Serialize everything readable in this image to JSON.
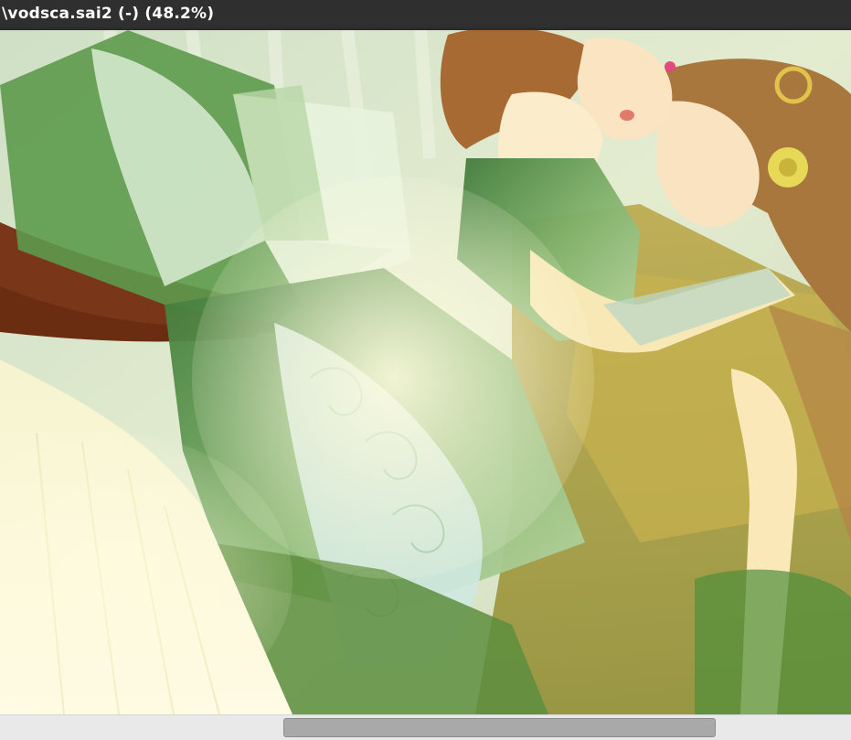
{
  "window": {
    "title": "\\vodsca.sai2 (-) (48.2%)"
  },
  "canvas": {
    "content": "illustration",
    "zoom_percent": 48.2
  },
  "scrollbar": {
    "horizontal_position_fraction": 0.333,
    "horizontal_visible_fraction": 0.508
  },
  "colors": {
    "titlebar_bg": "#2f2f2f",
    "title_text": "#ffffff",
    "scroll_track": "#e9e9e9",
    "scroll_thumb": "#a9a9a9"
  }
}
